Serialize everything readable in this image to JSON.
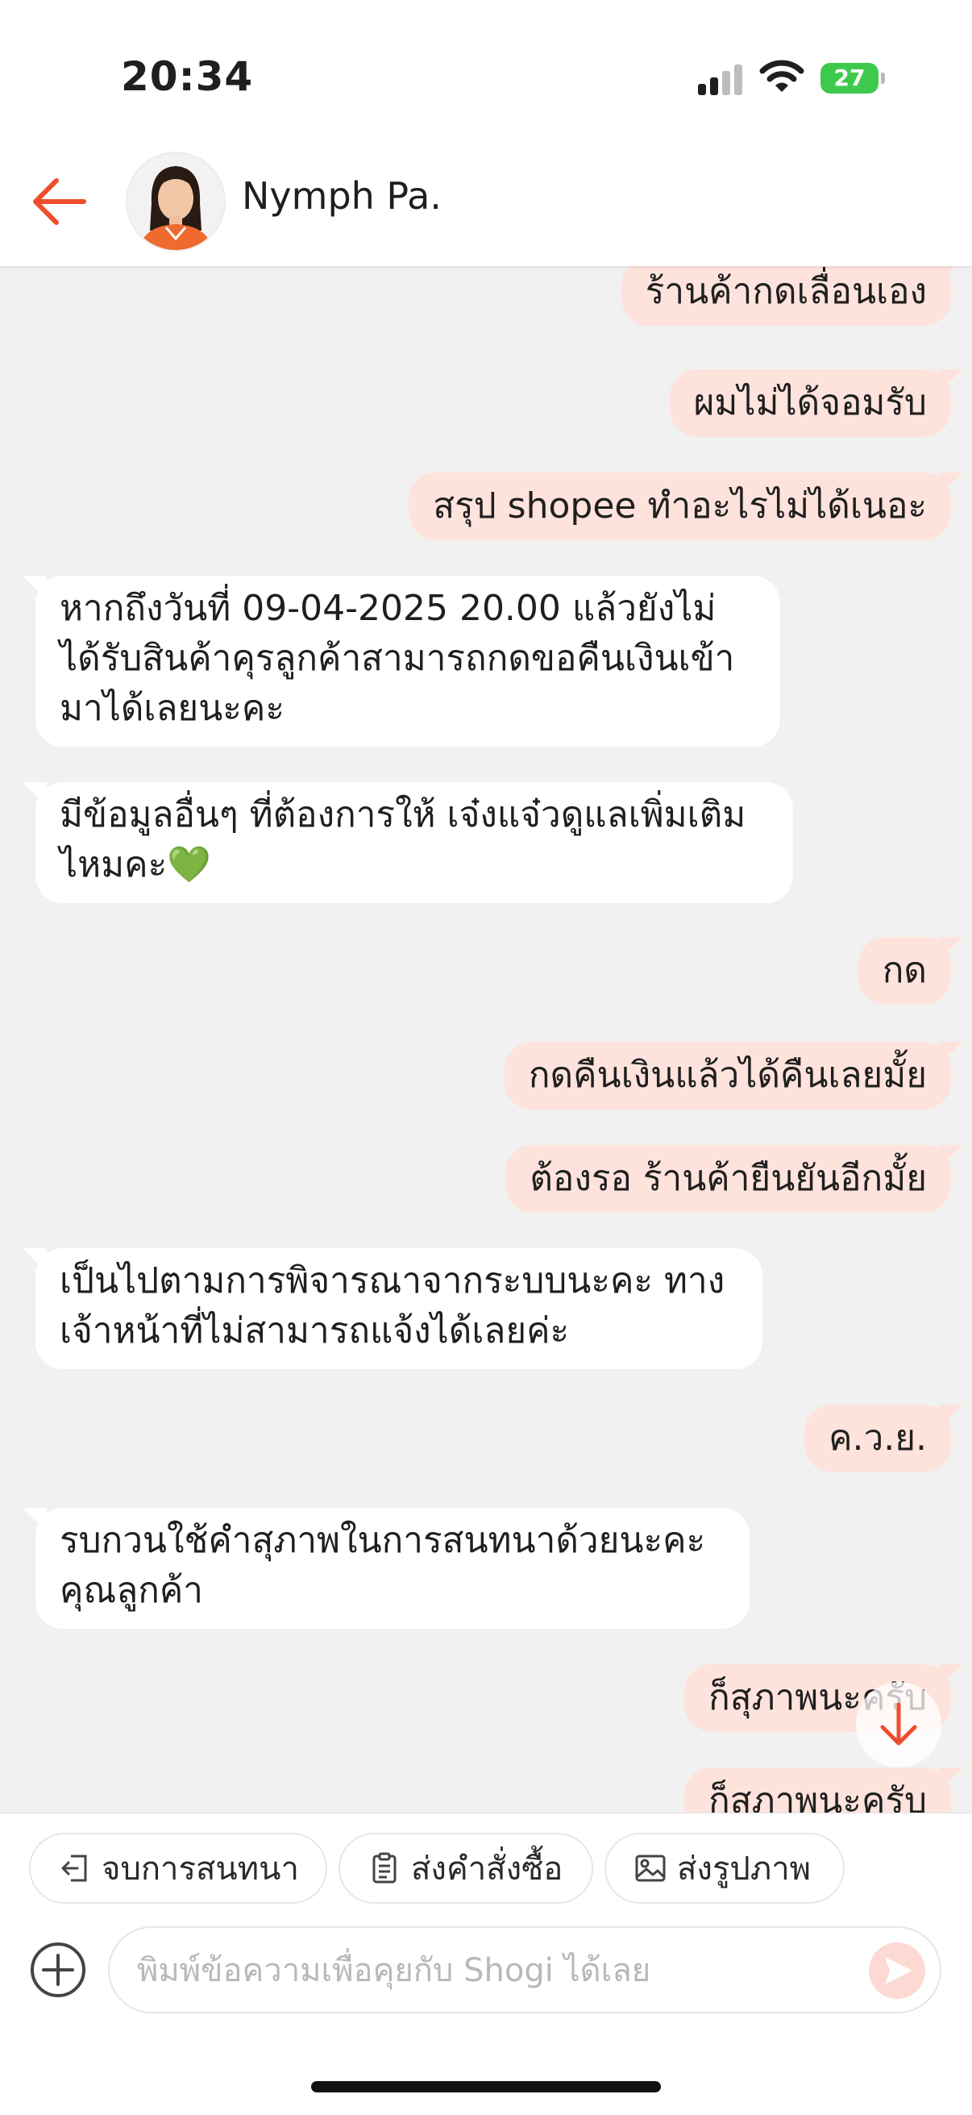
{
  "status_bar": {
    "time": "20:34",
    "battery": "27"
  },
  "header": {
    "contact_name": "Nymph Pa.",
    "back_icon": "arrow-left-icon",
    "accent_color": "#ee4d2d"
  },
  "messages": [
    {
      "direction": "out",
      "lines": [
        "ร้านค้ากดเลื่อนเอง"
      ]
    },
    {
      "direction": "out",
      "lines": [
        "ผมไม่ได้จอมรับ"
      ]
    },
    {
      "direction": "out",
      "lines": [
        "สรุป shopee ทำอะไรไม่ได้เนอะ"
      ]
    },
    {
      "direction": "in",
      "lines": [
        "หากถึงวันที่ 09-04-2025 20.00 แล้วยังไม่",
        "ได้รับสินค้าคุรลูกค้าสามารถกดขอคืนเงินเข้า",
        "มาได้เลยนะคะ"
      ]
    },
    {
      "direction": "in",
      "lines": [
        "มีข้อมูลอื่นๆ ที่ต้องการให้ เจ๋งแจ๋วดูแลเพิ่มเติม",
        "ไหมคะ💚"
      ]
    },
    {
      "direction": "out",
      "lines": [
        "กด"
      ]
    },
    {
      "direction": "out",
      "lines": [
        "กดคืนเงินแล้วได้คืนเลยมั้ย"
      ]
    },
    {
      "direction": "out",
      "lines": [
        "ต้องรอ ร้านค้ายืนยันอีกมั้ย"
      ]
    },
    {
      "direction": "in",
      "lines": [
        "เป็นไปตามการพิจารณาจากระบบนะคะ ทาง",
        "เจ้าหน้าที่ไม่สามารถแจ้งได้เลยค่ะ"
      ]
    },
    {
      "direction": "out",
      "lines": [
        "ค.ว.ย."
      ]
    },
    {
      "direction": "in",
      "lines": [
        "รบกวนใช้คำสุภาพในการสนทนาด้วยนะคะ",
        "คุณลูกค้า"
      ]
    },
    {
      "direction": "out",
      "lines": [
        "ก็สุภาพนะครับ"
      ]
    },
    {
      "direction": "out",
      "lines": [
        "ก็สุภาพนะครับ"
      ]
    }
  ],
  "quick_actions": [
    {
      "label": "จบการสนทนา",
      "icon": "exit-icon"
    },
    {
      "label": "ส่งคำสั่งซื้อ",
      "icon": "clipboard-icon"
    },
    {
      "label": "ส่งรูปภาพ",
      "icon": "image-icon"
    }
  ],
  "composer": {
    "placeholder": "พิมพ์ข้อความเพื่อคุยกับ Shogi ได้เลย",
    "value": ""
  }
}
